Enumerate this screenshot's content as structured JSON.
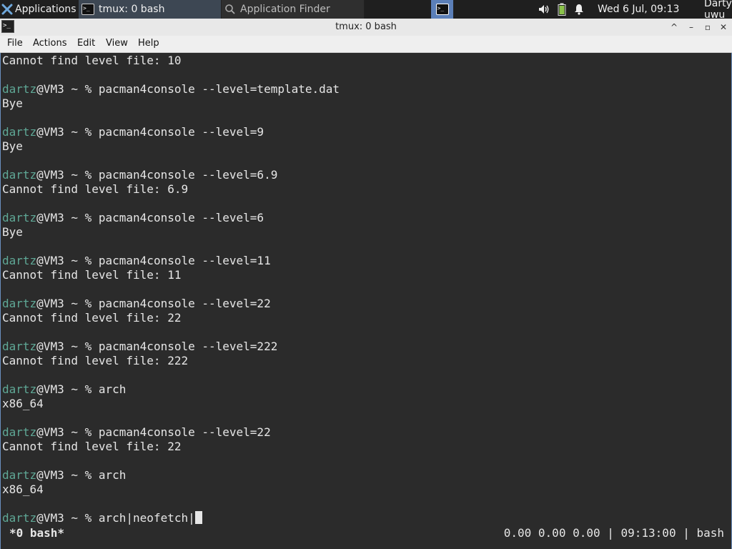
{
  "panel": {
    "applications_label": "Applications",
    "tasks": [
      {
        "label": "tmux: 0 bash"
      },
      {
        "label": "Application Finder"
      }
    ],
    "clock": "Wed  6 Jul, 09:13",
    "user": "Darty uwu",
    "icons": [
      "xfce-logo-icon",
      "terminal-icon",
      "search-icon",
      "volume-icon",
      "battery-icon",
      "notification-bell-icon"
    ]
  },
  "window": {
    "title": "tmux: 0 bash",
    "controls": [
      "^",
      "–",
      "▫",
      "✕"
    ]
  },
  "menu": [
    "File",
    "Actions",
    "Edit",
    "View",
    "Help"
  ],
  "terminal": {
    "prompt_user": "dartz",
    "prompt_rest": "@VM3 ~ % ",
    "lines": [
      {
        "type": "output",
        "text": "Cannot find level file: 10"
      },
      {
        "type": "blank",
        "text": ""
      },
      {
        "type": "prompt",
        "text": "pacman4console --level=template.dat"
      },
      {
        "type": "output",
        "text": "Bye"
      },
      {
        "type": "blank",
        "text": ""
      },
      {
        "type": "prompt",
        "text": "pacman4console --level=9"
      },
      {
        "type": "output",
        "text": "Bye"
      },
      {
        "type": "blank",
        "text": ""
      },
      {
        "type": "prompt",
        "text": "pacman4console --level=6.9"
      },
      {
        "type": "output",
        "text": "Cannot find level file: 6.9"
      },
      {
        "type": "blank",
        "text": ""
      },
      {
        "type": "prompt",
        "text": "pacman4console --level=6"
      },
      {
        "type": "output",
        "text": "Bye"
      },
      {
        "type": "blank",
        "text": ""
      },
      {
        "type": "prompt",
        "text": "pacman4console --level=11"
      },
      {
        "type": "output",
        "text": "Cannot find level file: 11"
      },
      {
        "type": "blank",
        "text": ""
      },
      {
        "type": "prompt",
        "text": "pacman4console --level=22"
      },
      {
        "type": "output",
        "text": "Cannot find level file: 22"
      },
      {
        "type": "blank",
        "text": ""
      },
      {
        "type": "prompt",
        "text": "pacman4console --level=222"
      },
      {
        "type": "output",
        "text": "Cannot find level file: 222"
      },
      {
        "type": "blank",
        "text": ""
      },
      {
        "type": "prompt",
        "text": "arch"
      },
      {
        "type": "output",
        "text": "x86_64"
      },
      {
        "type": "blank",
        "text": ""
      },
      {
        "type": "prompt",
        "text": "pacman4console --level=22"
      },
      {
        "type": "output",
        "text": "Cannot find level file: 22"
      },
      {
        "type": "blank",
        "text": ""
      },
      {
        "type": "prompt",
        "text": "arch"
      },
      {
        "type": "output",
        "text": "x86_64"
      },
      {
        "type": "blank",
        "text": ""
      },
      {
        "type": "input",
        "text": "arch|neofetch|"
      }
    ],
    "status_left": "*0 bash*",
    "status_right": "0.00 0.00 0.00 | 09:13:00 | bash"
  },
  "colors": {
    "terminal_bg": "#2b2b2b",
    "prompt_user": "#5fa896",
    "text": "#e6e6e6"
  }
}
